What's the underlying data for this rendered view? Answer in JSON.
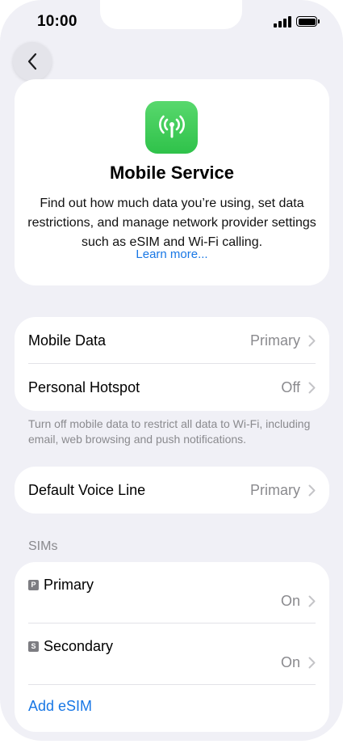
{
  "status_bar": {
    "time": "10:00"
  },
  "nav": {
    "back_icon": "chevron-left-icon"
  },
  "hero": {
    "icon": "antenna-icon",
    "icon_color": "#3fcb58",
    "title": "Mobile Service",
    "description": "Find out how much data you’re using, set data restrictions, and manage network provider settings such as eSIM and Wi-Fi calling.",
    "link": "Learn more..."
  },
  "data_group": {
    "rows": [
      {
        "label": "Mobile Data",
        "value": "Primary"
      },
      {
        "label": "Personal Hotspot",
        "value": "Off"
      }
    ],
    "footnote": "Turn off mobile data to restrict all data to Wi-Fi, including email, web browsing and push notifications."
  },
  "voice_group": {
    "label": "Default Voice Line",
    "value": "Primary"
  },
  "sims": {
    "header": "SIMs",
    "items": [
      {
        "badge": "P",
        "label": "Primary",
        "value": "On"
      },
      {
        "badge": "S",
        "label": "Secondary",
        "value": "On"
      }
    ],
    "add_label": "Add eSIM"
  },
  "colors": {
    "link": "#1877e5",
    "background": "#f0f0f6",
    "secondary_text": "#8a8a8e"
  }
}
